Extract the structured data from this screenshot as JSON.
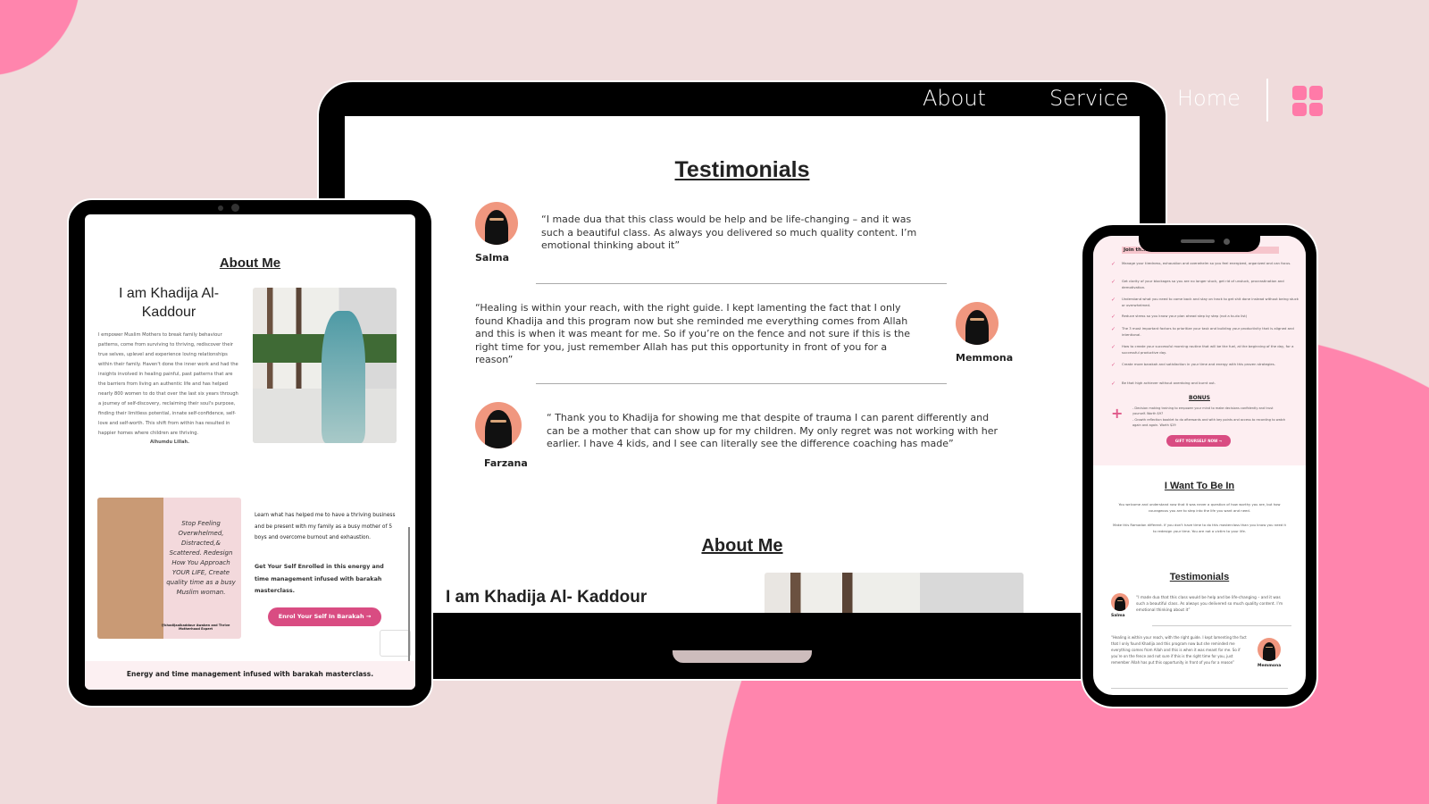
{
  "colors": {
    "accent": "#ff85ad",
    "button": "#d94c82",
    "background": "#efdcdc"
  },
  "nav": {
    "items": [
      {
        "label": "About"
      },
      {
        "label": "Service"
      },
      {
        "label": "Home"
      }
    ],
    "menu_icon": "grid-icon"
  },
  "desktop": {
    "testimonials_title": "Testimonials",
    "testimonials": [
      {
        "name": "Salma",
        "quote": "“I made dua that this class would be help and be life-changing – and it was such a beautiful class. As always you delivered so much quality content. I’m emotional thinking about it”"
      },
      {
        "name": "Memmona",
        "quote": "“Healing is within your reach, with the right guide. I kept lamenting the fact that I only found Khadija and this program now but she reminded me everything comes from Allah and this is when it was meant for me. So if you’re on the fence and not sure if this is the right time for you, just remember Allah has put this opportunity in front of you for a reason”"
      },
      {
        "name": "Farzana",
        "quote": "“ Thank you to Khadija for showing me that despite of trauma I can parent differently and can be a mother that can show up for my children. My only regret was not working with her earlier. I have 4 kids, and I see can literally see the difference coaching has made”"
      }
    ],
    "about_title": "About Me",
    "about_heading": "I am Khadija Al- Kaddour"
  },
  "tablet": {
    "about_title": "About Me",
    "heading": "I am Khadija Al-Kaddour",
    "bio": "I empower Muslim Mothers to break family behaviour patterns, come from surviving to thriving, rediscover their true selves, uplevel and experience loving relationships within their family. Haven't done the inner work and had the insights involved in healing painful, past patterns that are the barriers from living an authentic life and has helped nearly 800 women to do that over the last six years through a journey of self-discovery, reclaiming their soul's purpose, finding their limitless potential, innate self-confidence, self-love and self-worth. This shift from within has resulted in happier homes where children are thriving.",
    "bio_end": "Alhumdu Lillah.",
    "poster_text": "Stop Feeling Overwhelmed, Distracted,& Scattered. Redesign How You Approach YOUR LIFE, Create quality time as a busy Muslim woman.",
    "poster_caption": "@khadijaalkaddour Awaken and Thrive Motherhood Expert",
    "learn_text": "Learn what has helped me to have a thriving business and be present with my family as a busy mother of 5 boys and overcome burnout and exhaustion.",
    "enrol_text": "Get Your Self Enrolled in this energy and time management infused with barakah masterclass.",
    "enrol_button": "Enrol Your Self In Barakah →",
    "footer": "Energy and time management infused with barakah masterclass."
  },
  "phone": {
    "join_heading": "Join th... How to",
    "checklist": [
      "Manage your tiredness, exhaustion and overwhelm so you feel energized, organized and can focus.",
      "Get clarity of your blockages so you are no longer stuck, get rid of unstuck, procrastination and demotivation.",
      "Understand what you need to come back and stay on track to get shit done instead without being stuck or overwhelmed.",
      "Reduce stress so you know your plan ahead step by step (not a to-do list)",
      "The 3 most important factors to prioritize your task and building your productivity that is aligned and intentional.",
      "How to create your successful morning routine that will be the fuel, at the beginning of the day, for a successful productive day.",
      "Create more barakah and satisfaction in your time and energy with this proven strategies.",
      "Be that high achiever without overdoing and burnt out."
    ],
    "bonus_title": "BONUS",
    "bonus_items": [
      "- Decision making training to empower your mind to make decisions confidently and trust yourself. Worth $97",
      "- Growth reflection booklet to do afterwards and with key points and access to recording to watch again and again. Worth $29"
    ],
    "gift_button": "GIFT YOURSELF NOW →",
    "want_title": "I Want To Be In",
    "want_p1": "You welcome and understand now that it was never a question of how worthy you are, but how courageous you are to step into the life you want and need.",
    "want_p2": "Make this Ramadan different. If you don't have time to do this masterclass than you know you need it to redesign your time. You are not a victim to your life.",
    "testimonials_title": "Testimonials",
    "testimonials": [
      {
        "name": "Salma",
        "quote": "“I made dua that this class would be help and be life-changing – and it was such a beautiful class. As always you delivered so much quality content. I’m emotional thinking about it”"
      },
      {
        "name": "Memmona",
        "quote": "“Healing is within your reach, with the right guide. I kept lamenting the fact that I only found Khadija and this program now but she reminded me everything comes from Allah and this is when it was meant for me. So if you’re on the fence and not sure if this is the right time for you, just remember Allah has put this opportunity in front of you for a reason”"
      }
    ]
  }
}
